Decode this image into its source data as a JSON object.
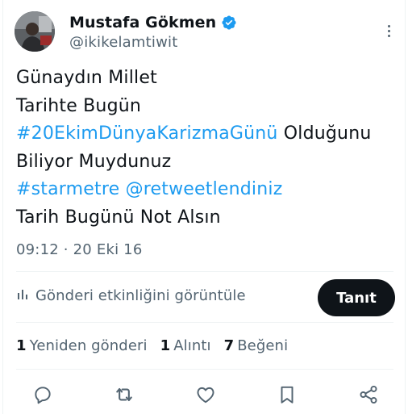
{
  "user": {
    "display_name": "Mustafa Gökmen",
    "handle": "@ikikelamtiwit",
    "verified": true
  },
  "tweet": {
    "line1": "Günaydın Millet",
    "line2": "Tarihte Bugün",
    "line3_hashtag": "#20EkimDünyaKarizmaGünü",
    "line3_text": " Olduğunu",
    "line4": "Biliyor Muydunuz",
    "line5_hashtag": "#starmetre",
    "line5_mention": "@retweetlendiniz",
    "line6": "Tarih Bugünü Not Alsın"
  },
  "meta": {
    "time": "09:12",
    "separator": " · ",
    "date": "20 Eki 16"
  },
  "analytics": {
    "label": "Gönderi etkinliğini görüntüle",
    "promote_label": "Tanıt"
  },
  "stats": {
    "reposts_count": "1",
    "reposts_label": "Yeniden gönderi",
    "quotes_count": "1",
    "quotes_label": "Alıntı",
    "likes_count": "7",
    "likes_label": "Beğeni"
  },
  "icons": {
    "verified": "verified-badge-icon",
    "more": "more-dots-icon",
    "analytics": "bar-chart-icon",
    "reply": "reply-icon",
    "repost": "repost-icon",
    "like": "heart-icon",
    "bookmark": "bookmark-icon",
    "share": "share-icon"
  },
  "colors": {
    "link": "#1d9bf0",
    "text": "#0f1419",
    "secondary": "#536471",
    "button_bg": "#0f1419"
  }
}
